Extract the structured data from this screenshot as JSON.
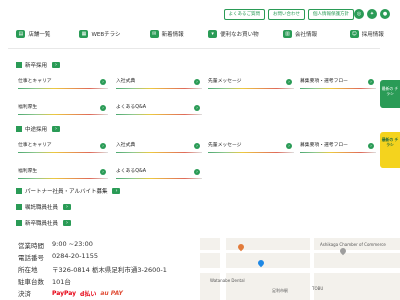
{
  "utility": {
    "faq": "よくあるご質問",
    "contact": "お問い合わせ",
    "privacy": "個人情報保護方針"
  },
  "social": [
    "instagram-icon",
    "twitter-icon",
    "line-icon"
  ],
  "nav": [
    {
      "label": "店舗一覧",
      "icon": "store-icon"
    },
    {
      "label": "WEBチラシ",
      "icon": "flyer-icon"
    },
    {
      "label": "新着情報",
      "icon": "news-icon"
    },
    {
      "label": "便利なお買い物",
      "icon": "cart-icon"
    },
    {
      "label": "会社情報",
      "icon": "building-icon"
    },
    {
      "label": "採用情報",
      "icon": "person-icon"
    }
  ],
  "sections": {
    "new_grad": "新卒採用",
    "mid_career": "中途採用",
    "part_time": "パートナー社員・アルバイト募集",
    "contract": "嘱託職員社員",
    "new_employee": "新卒職員社員"
  },
  "links": {
    "new_grad": [
      "仕事とキャリア",
      "入社式典",
      "先輩メッセージ",
      "募集要項・選考フロー",
      "福利厚生",
      "よくあるQ&A"
    ],
    "mid_career": [
      "仕事とキャリア",
      "入社式典",
      "先輩メッセージ",
      "募集要項・選考フロー",
      "福利厚生",
      "よくあるQ&A"
    ]
  },
  "info": {
    "hours_label": "営業時間",
    "hours_value": "9:00 ~23:00",
    "phone_label": "電話番号",
    "phone_value": "0284-20-1155",
    "address_label": "所在地",
    "address_value": "〒326-0814 栃木県足利市通3-2600-1",
    "parking_label": "駐車台数",
    "parking_value": "101台",
    "payment_label": "決済",
    "payments": [
      "PayPay",
      "d払い",
      "au PAY"
    ]
  },
  "map": {
    "labels": [
      "Watanabe Dental",
      "Ashikaga Chamber of Commerce",
      "TOBU",
      "足利市駅"
    ]
  },
  "side": {
    "top_badge": "最新の チラシ",
    "yellow_badge": "最新の チラシ"
  }
}
